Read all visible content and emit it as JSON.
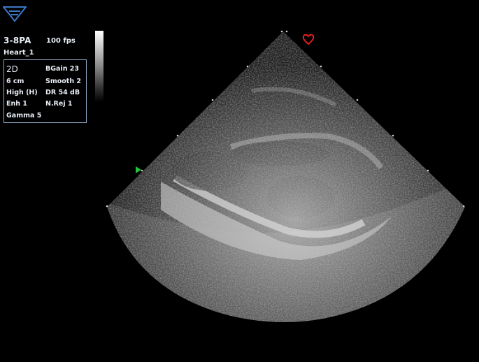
{
  "header": {
    "probe": "3-8PA",
    "frame_rate": "100 fps",
    "preset": "Heart_1"
  },
  "params": {
    "mode": "2D",
    "gain": "BGain 23",
    "depth": "6 cm",
    "smooth": "Smooth 2",
    "frequency": "High (H)",
    "dynamic_range": "DR 54 dB",
    "enhance": "Enh 1",
    "noise_reject": "N.Rej 1",
    "gamma": "Gamma 5"
  },
  "icons": {
    "logo": "brand-logo-icon",
    "orientation": "orientation-marker-icon",
    "heart": "heart-icon"
  },
  "colors": {
    "panel_text": "#e9eef6",
    "box_border": "#8ea8c6",
    "logo": "#3a78c6",
    "orientation_marker": "#22c43a",
    "heart": "#e02020"
  }
}
